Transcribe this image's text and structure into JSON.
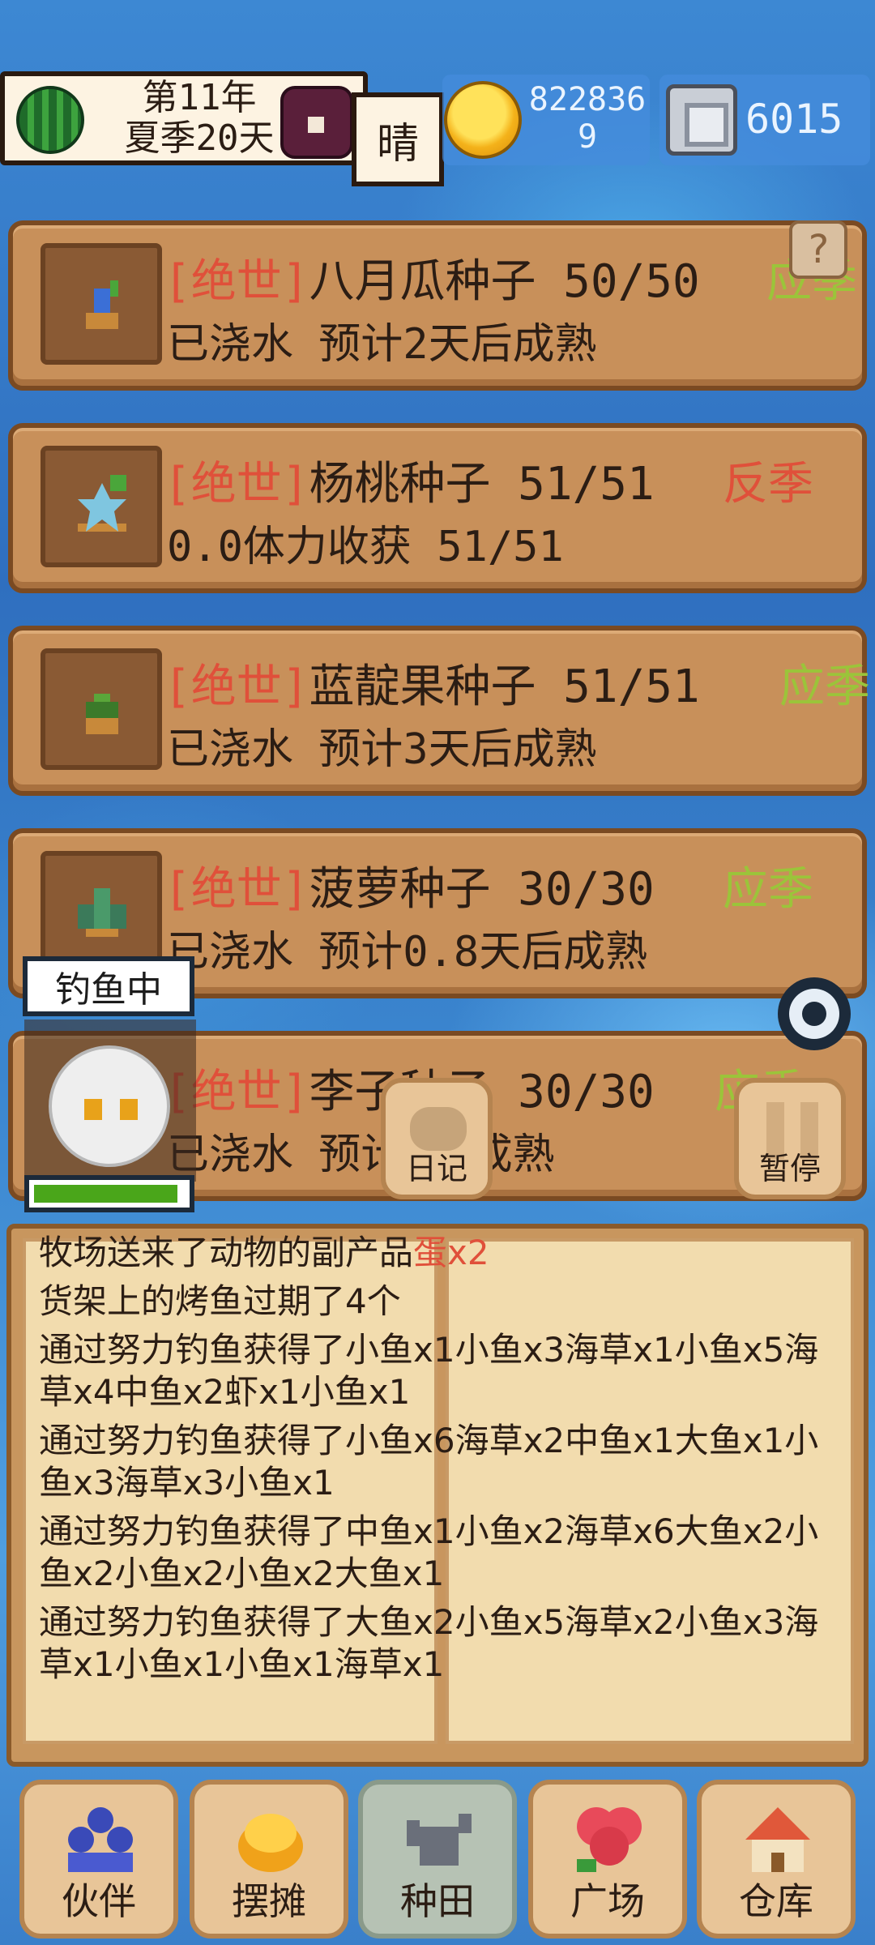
{
  "header": {
    "year": "第11年",
    "season_day": "夏季20天",
    "weather": "晴",
    "gold": "8228369",
    "gems": "6015"
  },
  "crops": [
    {
      "rarity": "[绝世]",
      "name": "八月瓜种子 50/50",
      "season": "应季",
      "season_type": "in",
      "status": "已浇水 预计2天后成熟",
      "help": "?"
    },
    {
      "rarity": "[绝世]",
      "name": "杨桃种子 51/51",
      "season": "反季",
      "season_type": "anti",
      "status": "0.0体力收获 51/51"
    },
    {
      "rarity": "[绝世]",
      "name": "蓝靛果种子 51/51",
      "season": "应季",
      "season_type": "in",
      "status": "已浇水 预计3天后成熟"
    },
    {
      "rarity": "[绝世]",
      "name": "菠萝种子 30/30",
      "season": "应季",
      "season_type": "in",
      "status": "已浇水 预计0.8天后成熟"
    },
    {
      "rarity": "[绝世]",
      "name": "李子种子 30/30",
      "season": "应季",
      "season_type": "in",
      "status": "已浇水 预计 后成熟"
    }
  ],
  "character": {
    "status": "钓鱼中",
    "stamina_fraction": 0.95
  },
  "buttons": {
    "diary": "日记",
    "pause": "暂停"
  },
  "log": {
    "line1_text": "牧场送来了动物的副产品",
    "line1_item": "蛋x2",
    "line2": "货架上的烤鱼过期了4个",
    "entries": [
      "通过努力钓鱼获得了小鱼x1小鱼x3海草x1小鱼x5海草x4中鱼x2虾x1小鱼x1",
      "通过努力钓鱼获得了小鱼x6海草x2中鱼x1大鱼x1小鱼x3海草x3小鱼x1",
      "通过努力钓鱼获得了中鱼x1小鱼x2海草x6大鱼x2小鱼x2小鱼x2小鱼x2大鱼x1",
      "通过努力钓鱼获得了大鱼x2小鱼x5海草x2小鱼x3海草x1小鱼x1小鱼x1海草x1"
    ]
  },
  "nav": [
    {
      "label": "伙伴",
      "icon": "companion-icon"
    },
    {
      "label": "摆摊",
      "icon": "stall-icon"
    },
    {
      "label": "种田",
      "icon": "watering-can-icon"
    },
    {
      "label": "广场",
      "icon": "flower-icon"
    },
    {
      "label": "仓库",
      "icon": "house-icon"
    }
  ],
  "colors": {
    "rare": "#e0503a",
    "in_season": "#9bc43a",
    "anti_season": "#e0503a",
    "card": "#c8905a"
  }
}
